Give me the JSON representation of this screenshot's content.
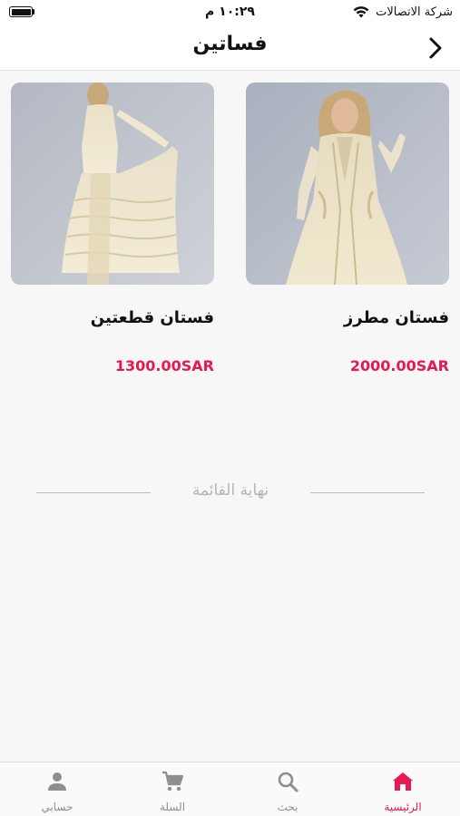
{
  "status_bar": {
    "carrier": "شركة الاتصالات",
    "time": "١٠:٢٩ م"
  },
  "nav": {
    "title": "فساتين"
  },
  "products": [
    {
      "name": "فستان مطرز",
      "price": "2000.00SAR"
    },
    {
      "name": "فستان قطعتين",
      "price": "1300.00SAR"
    }
  ],
  "list_end": "نهاية القائمة",
  "tabs": {
    "home": "الرئيسية",
    "search": "بحث",
    "cart": "السلة",
    "account": "حسابي",
    "active": "home"
  },
  "colors": {
    "accent": "#e8194f",
    "inactive": "#8e8e8e"
  },
  "icons": [
    "battery-icon",
    "wifi-icon",
    "back-chevron-icon",
    "home-icon",
    "search-icon",
    "cart-icon",
    "person-icon"
  ]
}
